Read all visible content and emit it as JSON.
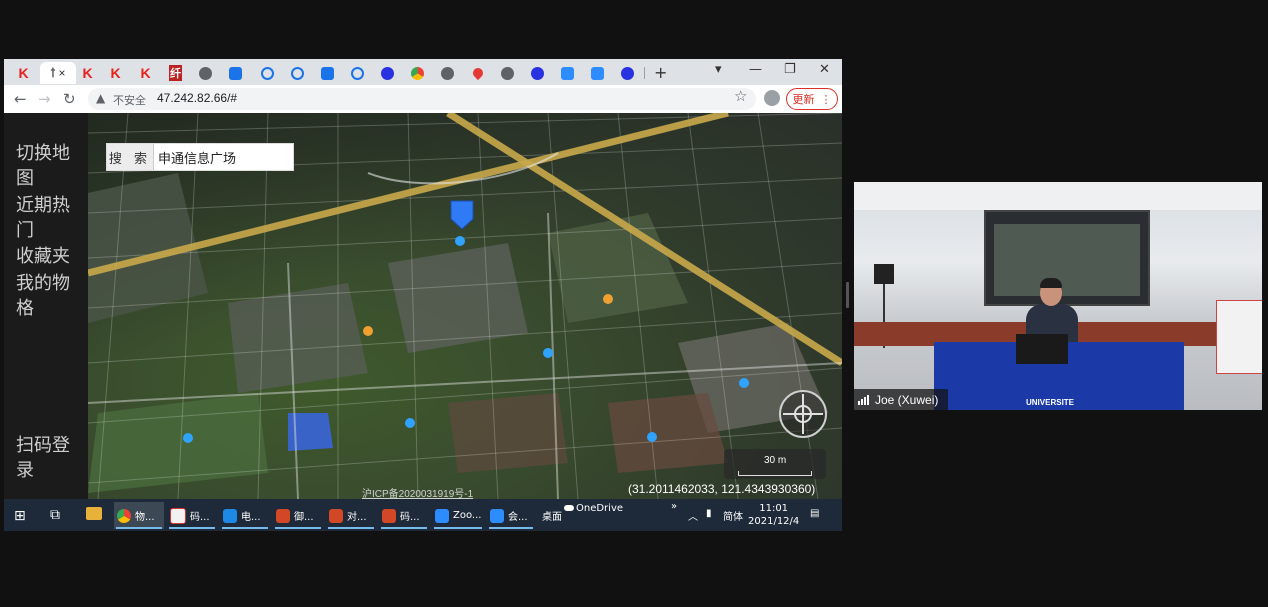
{
  "browser": {
    "tabs": [
      {
        "icon": "K"
      },
      {
        "icon": "ꝉ",
        "close": "×"
      },
      {
        "icon": "K"
      },
      {
        "icon": "K"
      },
      {
        "icon": "K"
      },
      {
        "icon": "纤"
      }
    ],
    "new_tab": "+",
    "window_controls": [
      "▾",
      "—",
      "❐",
      "✕"
    ],
    "nav": {
      "back": "←",
      "forward": "→",
      "reload": "↻"
    },
    "security_label": "不安全",
    "url": "47.242.82.66/#",
    "update_button": "更新"
  },
  "sidebar": {
    "items": [
      "切换地图",
      "近期热门",
      "收藏夹",
      "我的物格"
    ],
    "login": "扫码登录"
  },
  "map": {
    "search_label": "搜 索",
    "search_value": "申通信息广场",
    "scale": "30 m",
    "icp": "沪ICP备2020031919号-1",
    "coordinates": "(31.2011462033, 121.4343930360)"
  },
  "taskbar": {
    "items": [
      {
        "label": "物...",
        "color": "#dd4b39"
      },
      {
        "label": "码...",
        "color": "#f2f2f2"
      },
      {
        "label": "电...",
        "color": "#1e88e5"
      },
      {
        "label": "御...",
        "color": "#d24726"
      },
      {
        "label": "对...",
        "color": "#d24726"
      },
      {
        "label": "码...",
        "color": "#d24726"
      },
      {
        "label": "Zoo...",
        "color": "#2d8cff"
      },
      {
        "label": "会...",
        "color": "#2d8cff"
      }
    ],
    "desktop_label": "桌面",
    "onedrive_label": "OneDrive",
    "ime_label": "简体",
    "time": "11:01",
    "date": "2021/12/4"
  },
  "video": {
    "participant_name": "Joe (Xuwei)",
    "banner_text": "UNIVERSITE"
  },
  "colors": {
    "update_red": "#d93025",
    "taskbar": "#1e2a3a",
    "video_desk_blue": "#1b3aa8"
  }
}
